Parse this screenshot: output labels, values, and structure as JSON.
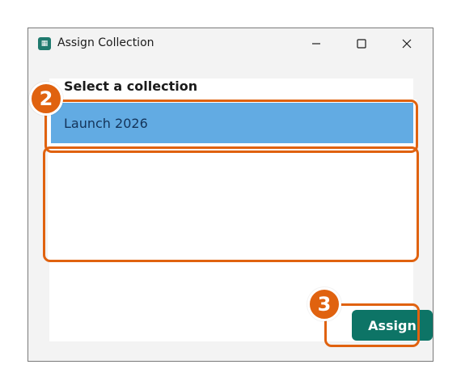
{
  "window": {
    "title": "Assign Collection",
    "icon": "app-icon",
    "controls": [
      "minimize-icon",
      "maximize-icon",
      "close-icon"
    ]
  },
  "content": {
    "heading": "Select a collection",
    "collections": [
      "Launch 2026"
    ],
    "selected": "Launch 2026",
    "assign_label": "Assign"
  },
  "annotations": {
    "step2": "2",
    "step3": "3",
    "color": "#e0620f"
  },
  "colors": {
    "selection": "#62abe3",
    "button": "#0d7466"
  }
}
